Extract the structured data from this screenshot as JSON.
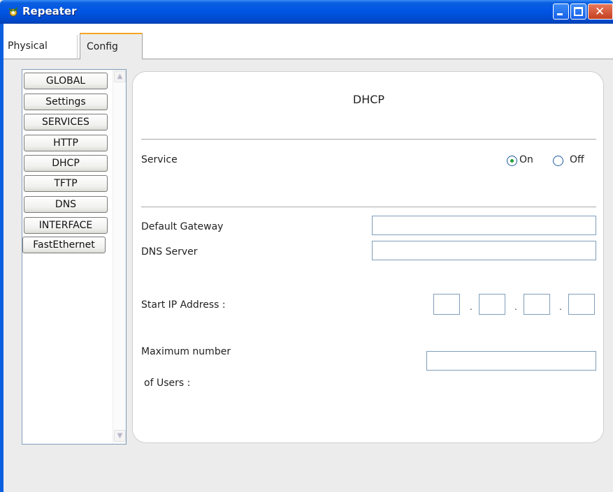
{
  "window": {
    "title": "Repeater",
    "icon": "repeater-icon"
  },
  "tabs": [
    {
      "label": "Physical",
      "active": false
    },
    {
      "label": "Config",
      "active": true
    }
  ],
  "sidebar": {
    "items": [
      {
        "label": "GLOBAL"
      },
      {
        "label": "Settings"
      },
      {
        "label": "SERVICES"
      },
      {
        "label": "HTTP"
      },
      {
        "label": "DHCP",
        "selected": true
      },
      {
        "label": "TFTP"
      },
      {
        "label": "DNS"
      },
      {
        "label": "INTERFACE"
      },
      {
        "label": "FastEthernet"
      }
    ]
  },
  "dhcp": {
    "title": "DHCP",
    "service_label": "Service",
    "service_options": [
      {
        "label": "On",
        "checked": true
      },
      {
        "label": "Off",
        "checked": false
      }
    ],
    "default_gateway_label": "Default Gateway",
    "default_gateway_value": "",
    "dns_server_label": "DNS Server",
    "dns_server_value": "",
    "start_ip_label": "Start IP Address :",
    "start_ip_octets": [
      "",
      "",
      "",
      ""
    ],
    "max_users_label_line1": "Maximum number",
    "max_users_label_line2": "of Users :",
    "max_users_value": ""
  },
  "colors": {
    "titlebar": "#0054e3",
    "active_tab_accent": "#f5a623",
    "radio_checked_dot": "#1fa03a"
  }
}
